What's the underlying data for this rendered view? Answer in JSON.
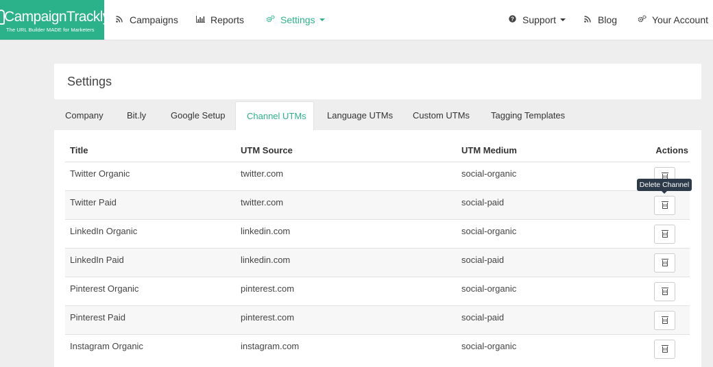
{
  "brand": {
    "name": "CampaignTrackly",
    "tagline": "The URL Builder MADE for Marketers",
    "accent_color": "#2cb28a"
  },
  "nav": {
    "campaigns": "Campaigns",
    "reports": "Reports",
    "settings": "Settings",
    "support": "Support",
    "blog": "Blog",
    "account": "Your Account"
  },
  "page": {
    "title": "Settings"
  },
  "tabs": [
    {
      "label": "Company"
    },
    {
      "label": "Bit.ly"
    },
    {
      "label": "Google Setup"
    },
    {
      "label": "Channel UTMs",
      "active": true
    },
    {
      "label": "Language UTMs"
    },
    {
      "label": "Custom UTMs"
    },
    {
      "label": "Tagging Templates"
    }
  ],
  "table": {
    "columns": [
      "Title",
      "UTM Source",
      "UTM Medium",
      "Actions"
    ],
    "rows": [
      {
        "title": "Twitter Organic",
        "source": "twitter.com",
        "medium": "social-organic"
      },
      {
        "title": "Twitter Paid",
        "source": "twitter.com",
        "medium": "social-paid"
      },
      {
        "title": "LinkedIn Organic",
        "source": "linkedin.com",
        "medium": "social-organic"
      },
      {
        "title": "LinkedIn Paid",
        "source": "linkedin.com",
        "medium": "social-paid"
      },
      {
        "title": "Pinterest Organic",
        "source": "pinterest.com",
        "medium": "social-organic"
      },
      {
        "title": "Pinterest Paid",
        "source": "pinterest.com",
        "medium": "social-paid"
      },
      {
        "title": "Instagram Organic",
        "source": "instagram.com",
        "medium": "social-organic"
      }
    ]
  },
  "tooltip": {
    "text": "Delete Channel"
  },
  "icons": {
    "campaigns": "rss-icon",
    "reports": "bar-chart-icon",
    "settings": "gears-icon",
    "support": "question-circle-icon",
    "blog": "rss-icon",
    "account": "gears-icon",
    "delete": "trash-icon"
  }
}
